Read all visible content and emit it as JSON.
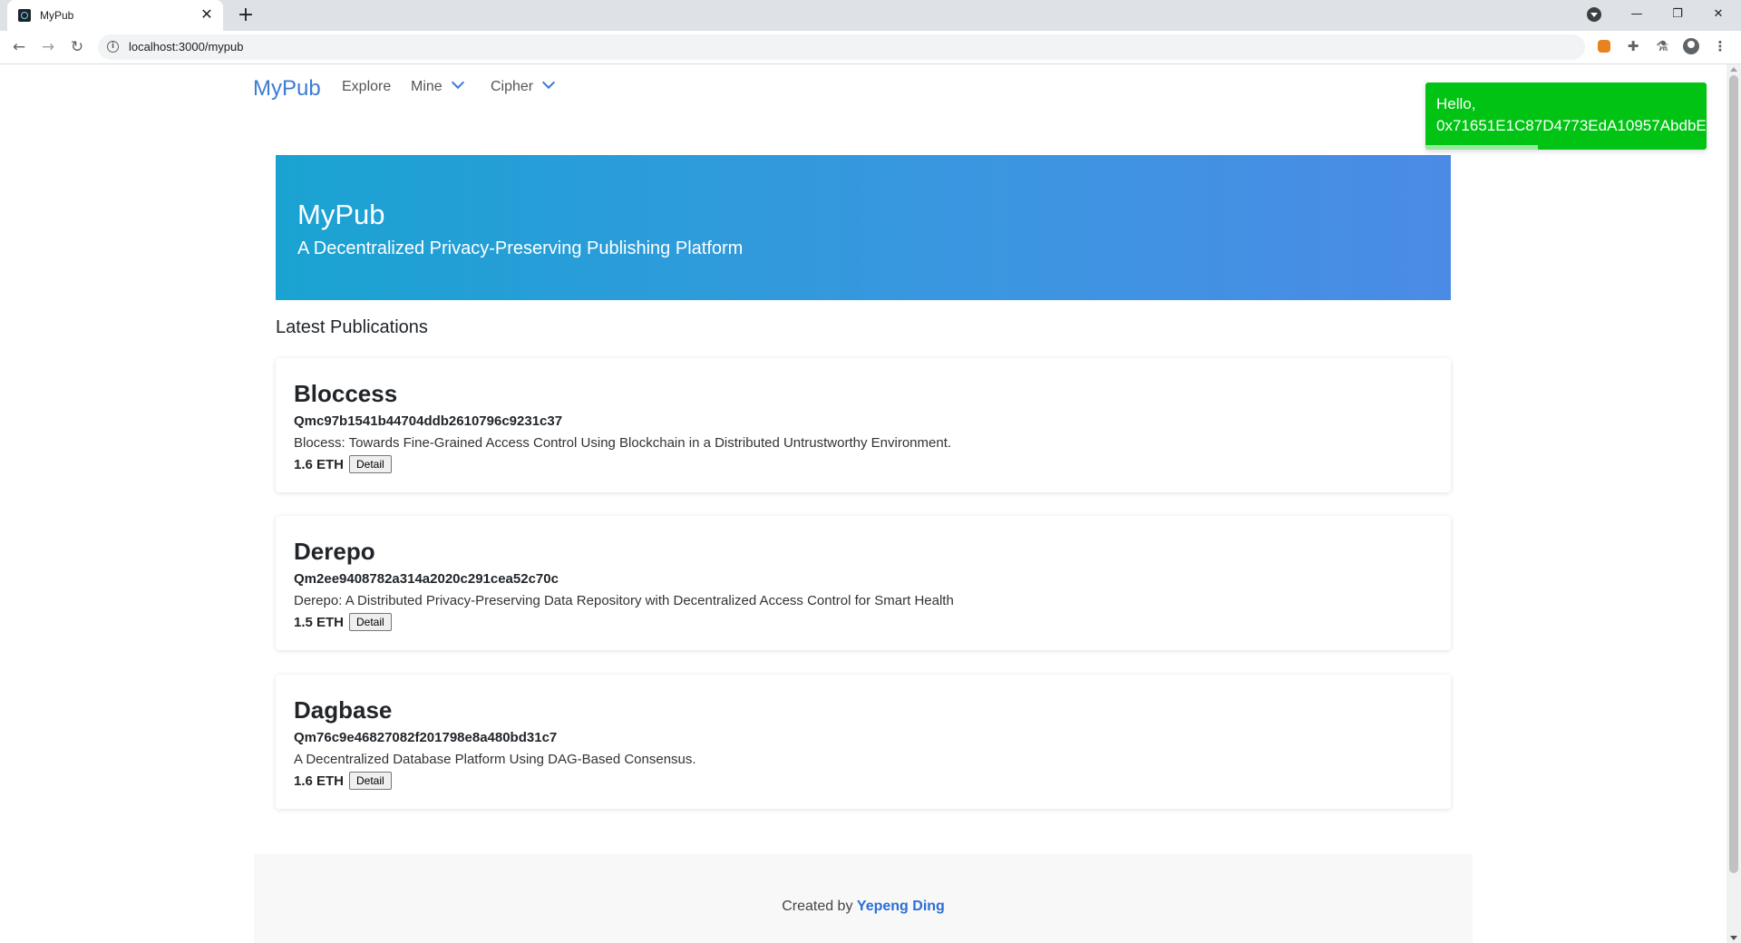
{
  "browser": {
    "tab_title": "MyPub",
    "tab_close": "✕",
    "new_tab": "+",
    "url": "localhost:3000/mypub",
    "window_controls": {
      "minimize": "—",
      "restore": "❐",
      "close": "✕"
    }
  },
  "nav": {
    "brand": "MyPub",
    "items": [
      {
        "label": "Explore"
      },
      {
        "label": "Mine"
      },
      {
        "label": "Cipher"
      }
    ]
  },
  "toast": {
    "line1": "Hello,",
    "line2": "0x71651E1C87D4773EdA10957AbdbE",
    "progress": 0.4,
    "color": "#00c313"
  },
  "hero": {
    "title": "MyPub",
    "subtitle": "A Decentralized Privacy-Preserving Publishing Platform"
  },
  "section_title": "Latest Publications",
  "publications": [
    {
      "name": "Bloccess",
      "hash": "Qmc97b1541b44704ddb2610796c9231c37",
      "description": "Blocess: Towards Fine-Grained Access Control Using Blockchain in a Distributed Untrustworthy Environment.",
      "price": "1.6 ETH",
      "button": "Detail"
    },
    {
      "name": "Derepo",
      "hash": "Qm2ee9408782a314a2020c291cea52c70c",
      "description": "Derepo: A Distributed Privacy-Preserving Data Repository with Decentralized Access Control for Smart Health",
      "price": "1.5 ETH",
      "button": "Detail"
    },
    {
      "name": "Dagbase",
      "hash": "Qm76c9e46827082f201798e8a480bd31c7",
      "description": "A Decentralized Database Platform Using DAG-Based Consensus.",
      "price": "1.6 ETH",
      "button": "Detail"
    }
  ],
  "footer": {
    "prefix": "Created by ",
    "author": "Yepeng Ding"
  }
}
